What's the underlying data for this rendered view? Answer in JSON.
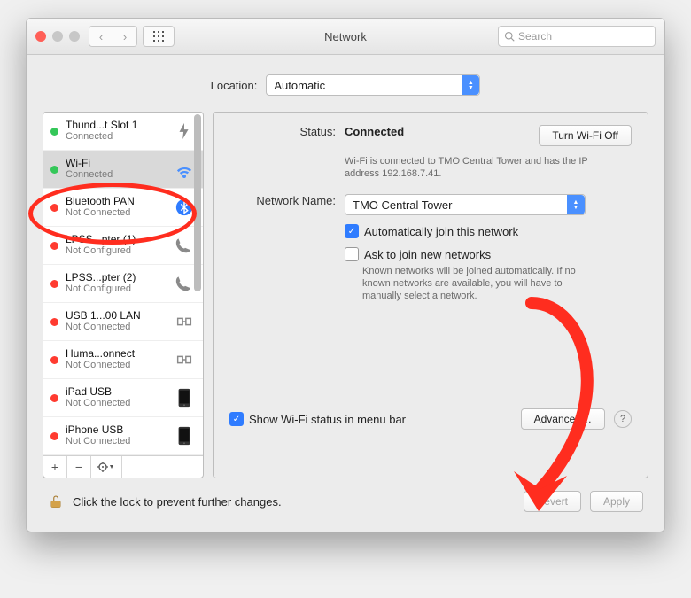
{
  "window": {
    "title": "Network",
    "search_placeholder": "Search"
  },
  "location": {
    "label": "Location:",
    "value": "Automatic"
  },
  "sidebar_items": [
    {
      "name": "Thund...t Slot 1",
      "status": "Connected",
      "dot": "green",
      "icon": "thunderbolt"
    },
    {
      "name": "Wi-Fi",
      "status": "Connected",
      "dot": "green",
      "icon": "wifi"
    },
    {
      "name": "Bluetooth PAN",
      "status": "Not Connected",
      "dot": "red",
      "icon": "bluetooth"
    },
    {
      "name": "LPSS...pter (1)",
      "status": "Not Configured",
      "dot": "red",
      "icon": "phone"
    },
    {
      "name": "LPSS...pter (2)",
      "status": "Not Configured",
      "dot": "red",
      "icon": "phone"
    },
    {
      "name": "USB 1...00 LAN",
      "status": "Not Connected",
      "dot": "red",
      "icon": "ethernet"
    },
    {
      "name": "Huma...onnect",
      "status": "Not Connected",
      "dot": "red",
      "icon": "ethernet"
    },
    {
      "name": "iPad USB",
      "status": "Not Connected",
      "dot": "red",
      "icon": "device"
    },
    {
      "name": "iPhone USB",
      "status": "Not Connected",
      "dot": "red",
      "icon": "device"
    }
  ],
  "status": {
    "label": "Status:",
    "value": "Connected",
    "button": "Turn Wi-Fi Off",
    "desc": "Wi-Fi is connected to TMO Central Tower and has the IP address 192.168.7.41."
  },
  "network_name": {
    "label": "Network Name:",
    "value": "TMO Central Tower",
    "auto_join": "Automatically join this network",
    "ask_join": "Ask to join new networks",
    "ask_desc": "Known networks will be joined automatically. If no known networks are available, you will have to manually select a network."
  },
  "show_status_label": "Show Wi-Fi status in menu bar",
  "advanced_button": "Advanced…",
  "lock_text": "Click the lock to prevent further changes.",
  "revert_button": "Revert",
  "apply_button": "Apply"
}
